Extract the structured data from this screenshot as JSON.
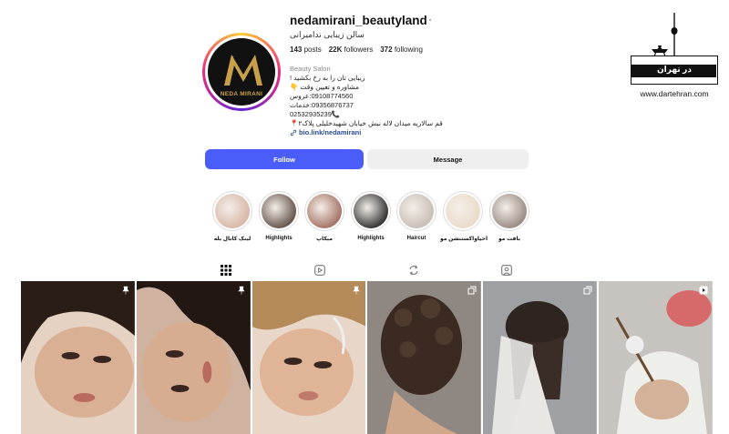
{
  "profile": {
    "username": "nedamirani_beautyland",
    "more": "···",
    "full_name": "سالن زیبایی ندامیرانی",
    "stats": {
      "posts_count": "143",
      "posts_label": "posts",
      "followers_count": "22K",
      "followers_label": "followers",
      "following_count": "372",
      "following_label": "following"
    },
    "category": "Beauty Salon",
    "bio_lines": [
      "زیبایی تان را به رخ بکشید !",
      "مشاوره و تعیین وقت 👇",
      "09108774560:عروس",
      "09356876737:خدمات",
      "02532935239📞",
      "قم سالاریه میدان لاله نبش خیابان شهیدخلیلی پلاک۲📍"
    ],
    "link": "bio.link/nedamirani",
    "avatar_text": "NEDA MIRANI"
  },
  "actions": {
    "follow": "Follow",
    "message": "Message"
  },
  "highlights": [
    {
      "label": "لینک کانال بله",
      "color": "#d9b8a8"
    },
    {
      "label": "Highlights",
      "color": "#6a5a52"
    },
    {
      "label": "میکاپ",
      "color": "#a7776a"
    },
    {
      "label": "Highlights",
      "color": "#3a3a3a"
    },
    {
      "label": "Haircut",
      "color": "#c9c0b6"
    },
    {
      "label": "احیاواکستنشن مو",
      "color": "#e9dccb"
    },
    {
      "label": "بافت مو",
      "color": "#9c8f88"
    }
  ],
  "tabs": [
    "grid-icon",
    "reels-icon",
    "reposts-icon",
    "tagged-icon"
  ],
  "posts": [
    {
      "badge": "pin-icon",
      "bg": "#c9a48a"
    },
    {
      "badge": "pin-icon",
      "bg": "#b88e78"
    },
    {
      "badge": "pin-icon",
      "bg": "#d2a88a"
    },
    {
      "badge": "carousel-icon",
      "bg": "#4a3a30"
    },
    {
      "badge": "carousel-icon",
      "bg": "#8e8f94"
    },
    {
      "badge": "reel-icon",
      "bg": "#a9a6a4"
    }
  ],
  "watermark": {
    "brand": "در تهران",
    "url": "www.dartehran.com"
  },
  "colors": {
    "follow": "#4a5df9",
    "message": "#efefef",
    "link": "#284b92"
  }
}
